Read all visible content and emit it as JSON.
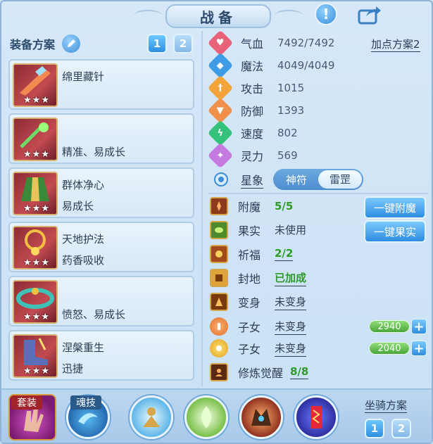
{
  "title": "战备",
  "left": {
    "header_label": "装备方案",
    "plan_buttons": [
      "1",
      "2"
    ],
    "equipment": [
      {
        "name": "绵里藏针",
        "trait": "",
        "stars": "★★★"
      },
      {
        "name": "",
        "trait": "精准、易成长",
        "stars": "★★★"
      },
      {
        "name": "群体净心",
        "trait": "易成长",
        "stars": "★★★"
      },
      {
        "name": "天地护法",
        "trait": "药香吸收",
        "stars": "★★★"
      },
      {
        "name": "",
        "trait": "愤怒、易成长",
        "stars": "★★★"
      },
      {
        "name": "涅槃重生",
        "trait": "迅捷",
        "stars": "★★★"
      }
    ]
  },
  "stats": {
    "plan_link": "加点方案2",
    "items": [
      {
        "label": "气血",
        "value": "7492/7492",
        "color": "#e8637a",
        "glyph": "♥"
      },
      {
        "label": "魔法",
        "value": "4049/4049",
        "color": "#3e9be6",
        "glyph": "◆"
      },
      {
        "label": "攻击",
        "value": "1015",
        "color": "#f2a43a",
        "glyph": "†"
      },
      {
        "label": "防御",
        "value": "1393",
        "color": "#f0904a",
        "glyph": "▼"
      },
      {
        "label": "速度",
        "value": "802",
        "color": "#35c27a",
        "glyph": "ϟ"
      },
      {
        "label": "灵力",
        "value": "569",
        "color": "#c67ae0",
        "glyph": "✦"
      }
    ],
    "star_label": "星象",
    "star_options": [
      "神符",
      "雷罡"
    ],
    "star_active": "雷罡"
  },
  "extras": {
    "rows": [
      {
        "label": "附魔",
        "value": "5/5",
        "style": "green"
      },
      {
        "label": "果实",
        "value": "未使用",
        "style": "plain"
      },
      {
        "label": "祈福",
        "value": "2/2",
        "style": "green-ul"
      },
      {
        "label": "封地",
        "value": "已加成",
        "style": "green-ul"
      },
      {
        "label": "变身",
        "value": "未变身",
        "style": "ul"
      },
      {
        "label": "子女",
        "value": "未变身",
        "style": "ul"
      },
      {
        "label": "子女",
        "value": "未变身",
        "style": "ul"
      },
      {
        "label": "修炼觉醒",
        "value": "8/8",
        "style": "green-ul"
      }
    ],
    "enchant_button": "一键附魔",
    "fruit_button": "一键果实",
    "child_gauges": [
      "2940",
      "2040"
    ],
    "plus": "+"
  },
  "bottom": {
    "set_tag": "套装",
    "soul_tag": "魂技",
    "mount_label": "坐骑方案",
    "mount_buttons": [
      "1",
      "2"
    ]
  },
  "icons": {
    "alert": "!",
    "stars": "★★★"
  }
}
